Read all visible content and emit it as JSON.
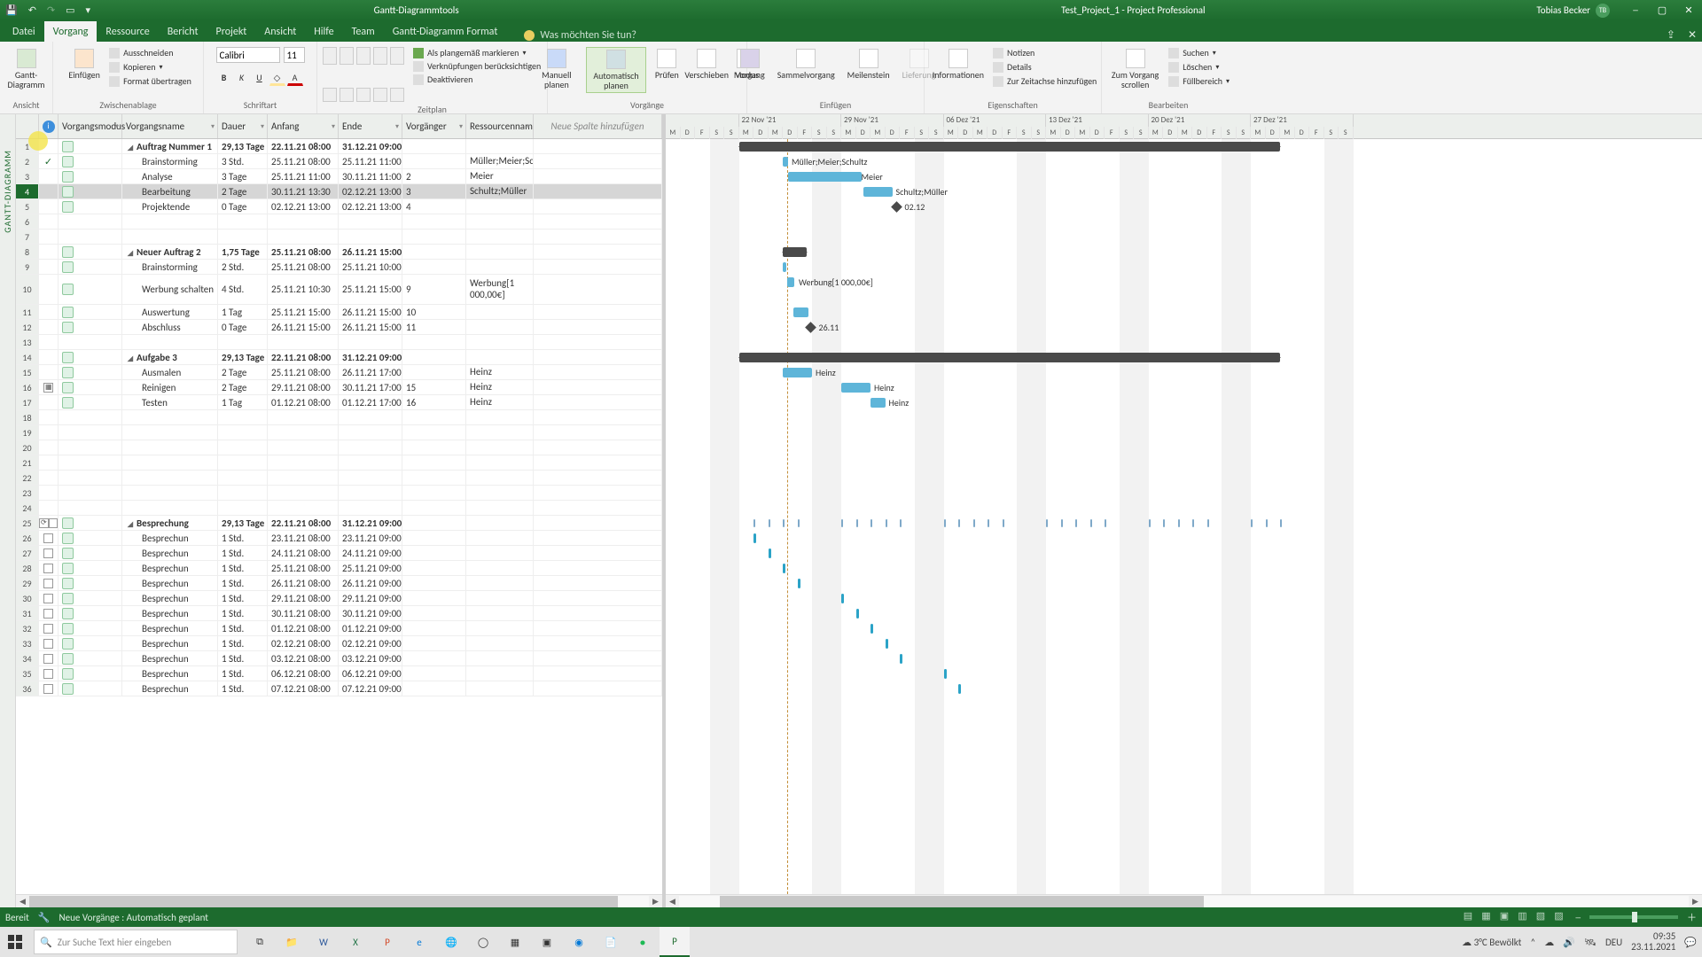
{
  "title": {
    "tools_caption": "Gantt-Diagrammtools",
    "document": "Test_Project_1 - Project Professional",
    "user": "Tobias Becker",
    "user_initials": "TB"
  },
  "menu": {
    "tabs": [
      "Datei",
      "Vorgang",
      "Ressource",
      "Bericht",
      "Projekt",
      "Ansicht",
      "Hilfe",
      "Team",
      "Gantt-Diagramm Format"
    ],
    "active": "Vorgang",
    "tell_me": "Was möchten Sie tun?"
  },
  "ribbon": {
    "groups": {
      "view": {
        "button": "Gantt-\nDiagramm",
        "label": "Ansicht"
      },
      "clipboard": {
        "paste": "Einfügen",
        "cut": "Ausschneiden",
        "copy": "Kopieren",
        "format_painter": "Format übertragen",
        "label": "Zwischenablage"
      },
      "font": {
        "name": "Calibri",
        "size": "11",
        "label": "Schriftart"
      },
      "schedule": {
        "on_track": "Als plangemäß markieren",
        "respect_links": "Verknüpfungen berücksichtigen",
        "deactivate": "Deaktivieren",
        "label": "Zeitplan"
      },
      "tasks": {
        "manual": "Manuell\nplanen",
        "auto": "Automatisch\nplanen",
        "inspect": "Prüfen",
        "move": "Verschieben",
        "mode": "Modus",
        "label": "Vorgänge"
      },
      "insert": {
        "task": "Vorgang",
        "summary": "Sammelvorgang",
        "milestone": "Meilenstein",
        "deliverable": "Lieferung",
        "label": "Einfügen"
      },
      "properties": {
        "information": "Informationen",
        "notes": "Notizen",
        "details": "Details",
        "add_timeline": "Zur Zeitachse hinzufügen",
        "label": "Eigenschaften"
      },
      "edit": {
        "scroll_to": "Zum Vorgang\nscrollen",
        "find": "Suchen",
        "clear": "Löschen",
        "fill": "Füllbereich",
        "label": "Bearbeiten"
      }
    }
  },
  "columns": {
    "info": "ⓘ",
    "mode": "Vorgangsmodus",
    "name": "Vorgangsname",
    "dur": "Dauer",
    "start": "Anfang",
    "end": "Ende",
    "pred": "Vorgänger",
    "res": "Ressourcennam",
    "newcol": "Neue Spalte hinzufügen"
  },
  "rows": [
    {
      "n": 1,
      "summary": true,
      "name": "Auftrag Nummer 1",
      "dur": "29,13 Tage",
      "start": "22.11.21 08:00",
      "end": "31.12.21 09:00"
    },
    {
      "n": 2,
      "ind": "check",
      "name": "Brainstorming",
      "dur": "3 Std.",
      "start": "25.11.21 08:00",
      "end": "25.11.21 11:00",
      "res": "Müller;Meier;Sch",
      "indent": 1
    },
    {
      "n": 3,
      "name": "Analyse",
      "dur": "3 Tage",
      "start": "25.11.21 11:00",
      "end": "30.11.21 11:00",
      "pred": "2",
      "res": "Meier",
      "indent": 1
    },
    {
      "n": 4,
      "selected": true,
      "name": "Bearbeitung",
      "dur": "2 Tage",
      "start": "30.11.21 13:30",
      "end": "02.12.21 13:00",
      "pred": "3",
      "res": "Schultz;Müller",
      "indent": 1
    },
    {
      "n": 5,
      "name": "Projektende",
      "dur": "0 Tage",
      "start": "02.12.21 13:00",
      "end": "02.12.21 13:00",
      "pred": "4",
      "indent": 1
    },
    {
      "n": 6
    },
    {
      "n": 7
    },
    {
      "n": 8,
      "summary": true,
      "name": "Neuer Auftrag 2",
      "dur": "1,75 Tage",
      "start": "25.11.21 08:00",
      "end": "26.11.21 15:00"
    },
    {
      "n": 9,
      "name": "Brainstorming",
      "dur": "2 Std.",
      "start": "25.11.21 08:00",
      "end": "25.11.21 10:00",
      "indent": 1
    },
    {
      "n": 10,
      "name": "Werbung schalten",
      "dur": "4 Std.",
      "start": "25.11.21 10:30",
      "end": "25.11.21 15:00",
      "pred": "9",
      "res": "Werbung[1 000,00€]",
      "indent": 1,
      "tall": true
    },
    {
      "n": 11,
      "name": "Auswertung",
      "dur": "1 Tag",
      "start": "25.11.21 15:00",
      "end": "26.11.21 15:00",
      "pred": "10",
      "indent": 1
    },
    {
      "n": 12,
      "name": "Abschluss",
      "dur": "0 Tage",
      "start": "26.11.21 15:00",
      "end": "26.11.21 15:00",
      "pred": "11",
      "indent": 1
    },
    {
      "n": 13
    },
    {
      "n": 14,
      "summary": true,
      "name": "Aufgabe 3",
      "dur": "29,13 Tage",
      "start": "22.11.21 08:00",
      "end": "31.12.21 09:00"
    },
    {
      "n": 15,
      "name": "Ausmalen",
      "dur": "2 Tage",
      "start": "25.11.21 08:00",
      "end": "26.11.21 17:00",
      "res": "Heinz",
      "indent": 1
    },
    {
      "n": 16,
      "ind": "cal",
      "name": "Reinigen",
      "dur": "2 Tage",
      "start": "29.11.21 08:00",
      "end": "30.11.21 17:00",
      "pred": "15",
      "res": "Heinz",
      "indent": 1
    },
    {
      "n": 17,
      "name": "Testen",
      "dur": "1 Tag",
      "start": "01.12.21 08:00",
      "end": "01.12.21 17:00",
      "pred": "16",
      "res": "Heinz",
      "indent": 1
    },
    {
      "n": 18
    },
    {
      "n": 19
    },
    {
      "n": 20
    },
    {
      "n": 21
    },
    {
      "n": 22
    },
    {
      "n": 23
    },
    {
      "n": 24
    },
    {
      "n": 25,
      "ind": "rec sp",
      "summary": true,
      "name": "Besprechung",
      "dur": "29,13 Tage",
      "start": "22.11.21 08:00",
      "end": "31.12.21 09:00",
      "align": "right"
    },
    {
      "n": 26,
      "ind": "sp",
      "name": "Besprechun",
      "dur": "1 Std.",
      "start": "23.11.21 08:00",
      "end": "23.11.21 09:00",
      "indent": 1
    },
    {
      "n": 27,
      "ind": "sp",
      "name": "Besprechun",
      "dur": "1 Std.",
      "start": "24.11.21 08:00",
      "end": "24.11.21 09:00",
      "indent": 1
    },
    {
      "n": 28,
      "ind": "sp",
      "name": "Besprechun",
      "dur": "1 Std.",
      "start": "25.11.21 08:00",
      "end": "25.11.21 09:00",
      "indent": 1
    },
    {
      "n": 29,
      "ind": "sp",
      "name": "Besprechun",
      "dur": "1 Std.",
      "start": "26.11.21 08:00",
      "end": "26.11.21 09:00",
      "indent": 1
    },
    {
      "n": 30,
      "ind": "sp",
      "name": "Besprechun",
      "dur": "1 Std.",
      "start": "29.11.21 08:00",
      "end": "29.11.21 09:00",
      "indent": 1
    },
    {
      "n": 31,
      "ind": "sp",
      "name": "Besprechun",
      "dur": "1 Std.",
      "start": "30.11.21 08:00",
      "end": "30.11.21 09:00",
      "indent": 1
    },
    {
      "n": 32,
      "ind": "sp",
      "name": "Besprechun",
      "dur": "1 Std.",
      "start": "01.12.21 08:00",
      "end": "01.12.21 09:00",
      "indent": 1
    },
    {
      "n": 33,
      "ind": "sp",
      "name": "Besprechun",
      "dur": "1 Std.",
      "start": "02.12.21 08:00",
      "end": "02.12.21 09:00",
      "indent": 1
    },
    {
      "n": 34,
      "ind": "sp",
      "name": "Besprechun",
      "dur": "1 Std.",
      "start": "03.12.21 08:00",
      "end": "03.12.21 09:00",
      "indent": 1
    },
    {
      "n": 35,
      "ind": "sp",
      "name": "Besprechun",
      "dur": "1 Std.",
      "start": "06.12.21 08:00",
      "end": "06.12.21 09:00",
      "indent": 1
    },
    {
      "n": 36,
      "ind": "sp",
      "name": "Besprechun",
      "dur": "1 Std.",
      "start": "07.12.21 08:00",
      "end": "07.12.21 09:00",
      "indent": 1
    }
  ],
  "gantt": {
    "weeks": [
      "22 Nov '21",
      "29 Nov '21",
      "06 Dez '21",
      "13 Dez '21",
      "20 Dez '21",
      "27 Dez '21"
    ],
    "days": [
      "M",
      "D",
      "M",
      "D",
      "F",
      "S",
      "S"
    ],
    "labels": {
      "r2": "Müller;Meier;Schultz",
      "r3": "Meier",
      "r4": "Schultz;Müller",
      "r5": "02.12",
      "r10": "Werbung[1 000,00€]",
      "r12": "26.11",
      "r15": "Heinz",
      "r16": "Heinz",
      "r17": "Heinz"
    }
  },
  "status": {
    "ready": "Bereit",
    "mode": "Neue Vorgänge : Automatisch geplant"
  },
  "taskbar": {
    "search": "Zur Suche Text hier eingeben",
    "weather": "3°C  Bewölkt",
    "lang": "DEU",
    "time": "09:35",
    "date": "23.11.2021"
  },
  "sidebar_label": "GANTT-DIAGRAMM"
}
